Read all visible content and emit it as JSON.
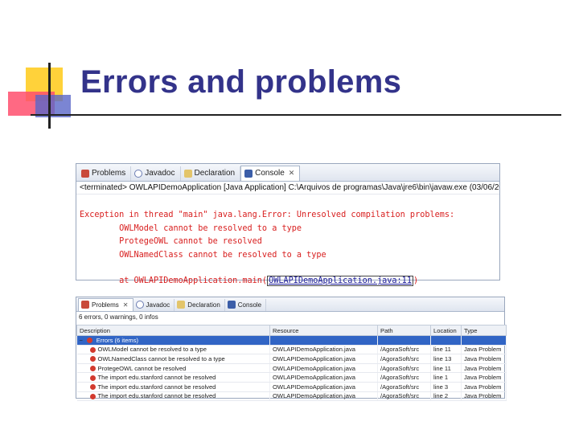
{
  "slide": {
    "title": "Errors and problems"
  },
  "console_panel": {
    "tabs": [
      {
        "label": "Problems"
      },
      {
        "label": "Javadoc"
      },
      {
        "label": "Declaration"
      },
      {
        "label": "Console",
        "active": true
      }
    ],
    "close_glyph": "✕",
    "header": "<terminated> OWLAPIDemoApplication [Java Application] C:\\Arquivos de programas\\Java\\jre6\\bin\\javaw.exe (03/06/2009 09:01:45)",
    "lines": [
      "Exception in thread \"main\" java.lang.Error: Unresolved compilation problems:",
      "        OWLModel cannot be resolved to a type",
      "        ProtegeOWL cannot be resolved",
      "        OWLNamedClass cannot be resolved to a type",
      "",
      "        at OWLAPIDemoApplication.main("
    ],
    "stack_link": "OWLAPIDemoApplication.java:11",
    "stack_suffix": ")"
  },
  "problems_panel": {
    "tabs": [
      {
        "label": "Problems",
        "active": true
      },
      {
        "label": "Javadoc"
      },
      {
        "label": "Declaration"
      },
      {
        "label": "Console"
      }
    ],
    "close_glyph": "✕",
    "summary": "6 errors, 0 warnings, 0 infos",
    "columns": [
      "Description",
      "Resource",
      "Path",
      "Location",
      "Type"
    ],
    "group_row": {
      "expander": "−",
      "label": "Errors (6 items)"
    },
    "rows": [
      [
        "OWLModel cannot be resolved to a type",
        "OWLAPIDemoApplication.java",
        "/AgoraSoft/src",
        "line 11",
        "Java Problem"
      ],
      [
        "OWLNamedClass cannot be resolved to a type",
        "OWLAPIDemoApplication.java",
        "/AgoraSoft/src",
        "line 13",
        "Java Problem"
      ],
      [
        "ProtegeOWL cannot be resolved",
        "OWLAPIDemoApplication.java",
        "/AgoraSoft/src",
        "line 11",
        "Java Problem"
      ],
      [
        "The import edu.stanford cannot be resolved",
        "OWLAPIDemoApplication.java",
        "/AgoraSoft/src",
        "line 1",
        "Java Problem"
      ],
      [
        "The import edu.stanford cannot be resolved",
        "OWLAPIDemoApplication.java",
        "/AgoraSoft/src",
        "line 3",
        "Java Problem"
      ],
      [
        "The import edu.stanford cannot be resolved",
        "OWLAPIDemoApplication.java",
        "/AgoraSoft/src",
        "line 2",
        "Java Problem"
      ]
    ]
  },
  "colors": {
    "title": "#33338a",
    "console_error_text": "#d81e1e",
    "selection": "#3165c5"
  }
}
